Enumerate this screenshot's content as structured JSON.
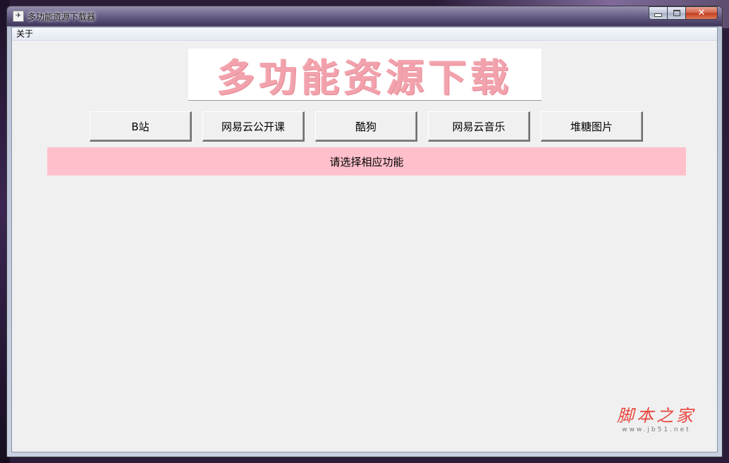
{
  "window": {
    "title": "多功能资源下载器",
    "app_icon_glyph": "✈",
    "controls": {
      "close_glyph": "✕"
    }
  },
  "menubar": {
    "items": [
      {
        "label": "关于"
      }
    ]
  },
  "banner": {
    "text": "多功能资源下载"
  },
  "buttons": [
    {
      "label": "B站"
    },
    {
      "label": "网易云公开课"
    },
    {
      "label": "酷狗"
    },
    {
      "label": "网易云音乐"
    },
    {
      "label": "堆糖图片"
    }
  ],
  "status": {
    "text": "请选择相应功能",
    "background": "#ffc0cb"
  },
  "watermark": {
    "main": "脚本之家",
    "url": "www.jb51.net"
  },
  "colors": {
    "banner_text": "#f2a2ac",
    "watermark": "#e8453c",
    "client_bg": "#f0f0f0"
  }
}
